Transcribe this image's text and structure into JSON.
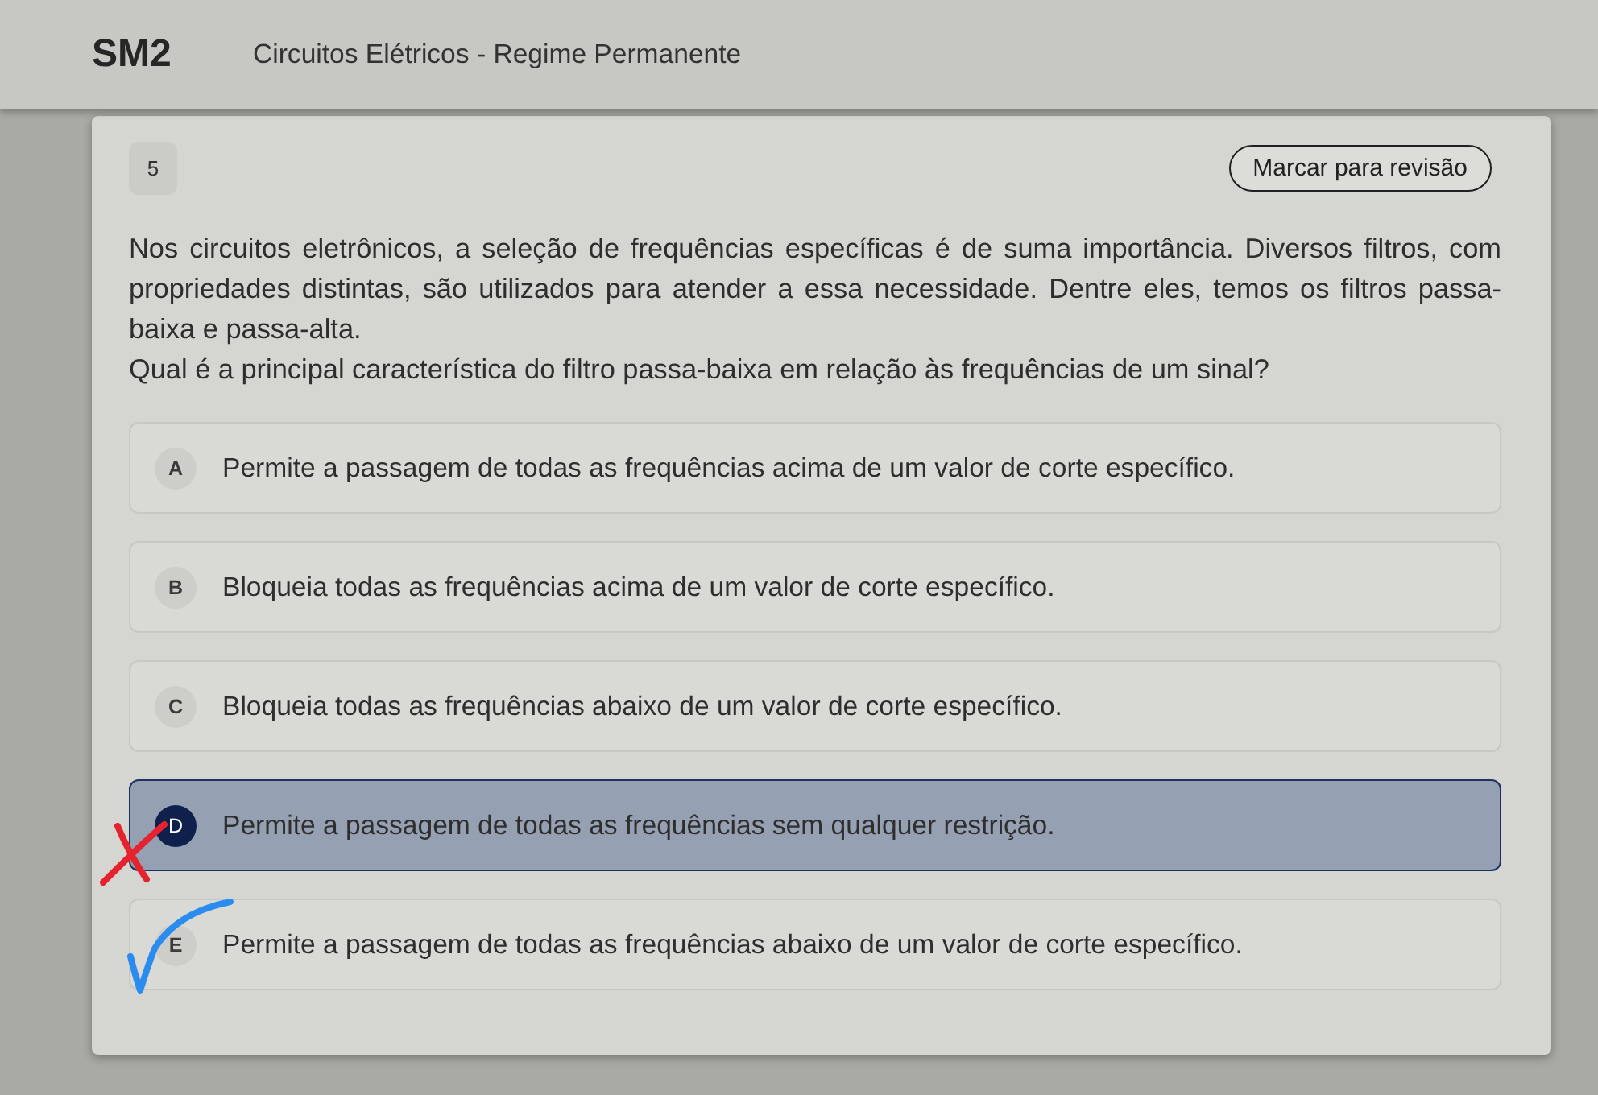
{
  "header": {
    "course_code": "SM2",
    "title": "Circuitos Elétricos - Regime Permanente"
  },
  "question": {
    "number": "5",
    "review_button": "Marcar para revisão",
    "paragraphs": [
      "Nos circuitos eletrônicos, a seleção de frequências específicas é de suma importância. Diversos filtros, com propriedades distintas, são utilizados para atender a essa necessidade. Dentre eles, temos os filtros passa-baixa e passa-alta.",
      "Qual é a principal característica do filtro passa-baixa em relação às frequências de um sinal?"
    ]
  },
  "options": [
    {
      "letter": "A",
      "text": "Permite a passagem de todas as frequências acima de um valor de corte específico.",
      "selected": false,
      "marked_wrong": false,
      "marked_correct": false
    },
    {
      "letter": "B",
      "text": "Bloqueia todas as frequências acima de um valor de corte específico.",
      "selected": false,
      "marked_wrong": false,
      "marked_correct": false
    },
    {
      "letter": "C",
      "text": "Bloqueia todas as frequências abaixo de um valor de corte específico.",
      "selected": false,
      "marked_wrong": false,
      "marked_correct": false
    },
    {
      "letter": "D",
      "text": "Permite a passagem de todas as frequências sem qualquer restrição.",
      "selected": true,
      "marked_wrong": true,
      "marked_correct": false
    },
    {
      "letter": "E",
      "text": "Permite a passagem de todas as frequências abaixo de um valor de corte específico.",
      "selected": false,
      "marked_wrong": false,
      "marked_correct": true
    }
  ]
}
